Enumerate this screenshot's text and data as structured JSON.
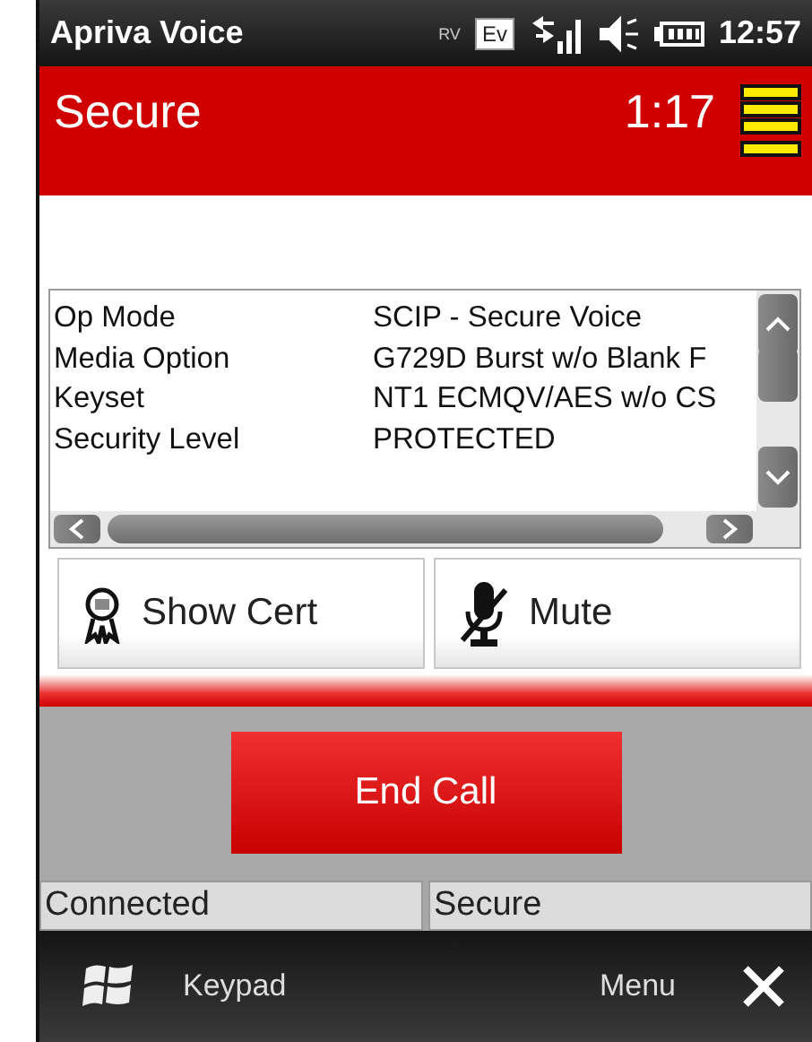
{
  "system_bar": {
    "title": "Apriva Voice",
    "roaming": "RV",
    "network": "Ev",
    "time": "12:57"
  },
  "header": {
    "title": "Secure",
    "timer": "1:17"
  },
  "details": [
    {
      "label": "Op Mode",
      "value": "SCIP - Secure Voice"
    },
    {
      "label": "Media Option",
      "value": "G729D Burst w/o Blank F"
    },
    {
      "label": "Keyset",
      "value": "NT1 ECMQV/AES w/o CS"
    },
    {
      "label": "Security Level",
      "value": "PROTECTED"
    }
  ],
  "actions": [
    {
      "kind": "cert",
      "label": "Show Cert"
    },
    {
      "kind": "mute",
      "label": "Mute"
    }
  ],
  "end_call": "End Call",
  "status_panes": [
    "Connected",
    "Secure"
  ],
  "softkeys": {
    "left": "Keypad",
    "right": "Menu"
  }
}
